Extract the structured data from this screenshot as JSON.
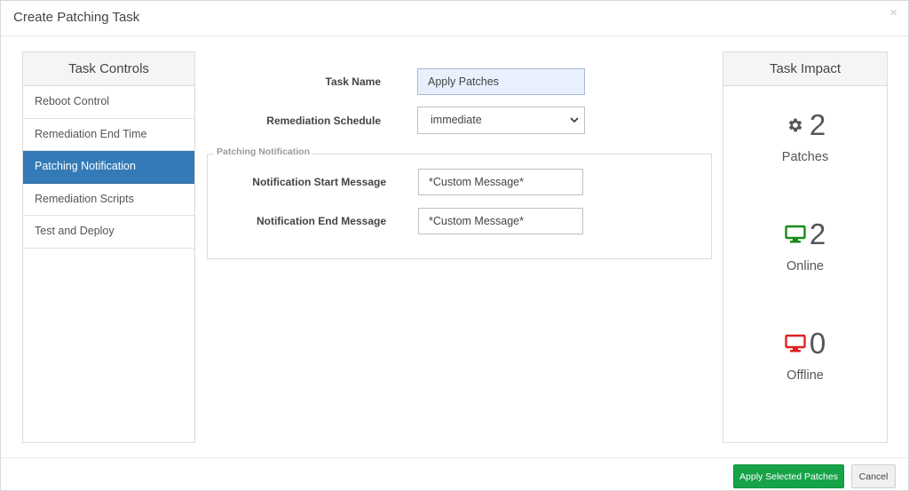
{
  "dialog": {
    "title": "Create Patching Task",
    "close_symbol": "×"
  },
  "task_controls": {
    "header": "Task Controls",
    "items": [
      {
        "label": "Reboot Control",
        "active": false
      },
      {
        "label": "Remediation End Time",
        "active": false
      },
      {
        "label": "Patching Notification",
        "active": true
      },
      {
        "label": "Remediation Scripts",
        "active": false
      },
      {
        "label": "Test and Deploy",
        "active": false
      }
    ]
  },
  "form": {
    "task_name_label": "Task Name",
    "task_name_value": "Apply Patches",
    "schedule_label": "Remediation Schedule",
    "schedule_value": "immediate",
    "notification_legend": "Patching Notification",
    "start_message_label": "Notification Start Message",
    "start_message_value": "*Custom Message*",
    "end_message_label": "Notification End Message",
    "end_message_value": "*Custom Message*"
  },
  "task_impact": {
    "header": "Task Impact",
    "metrics": [
      {
        "icon": "gear-icon",
        "count": "2",
        "label": "Patches",
        "color": "#555555"
      },
      {
        "icon": "monitor-icon",
        "count": "2",
        "label": "Online",
        "color": "#1a8a1a"
      },
      {
        "icon": "monitor-icon",
        "count": "0",
        "label": "Offline",
        "color": "#e02020"
      }
    ]
  },
  "footer": {
    "apply_label": "Apply Selected Patches",
    "cancel_label": "Cancel"
  },
  "colors": {
    "active_nav": "#337ab7",
    "primary_button": "#17a349"
  }
}
